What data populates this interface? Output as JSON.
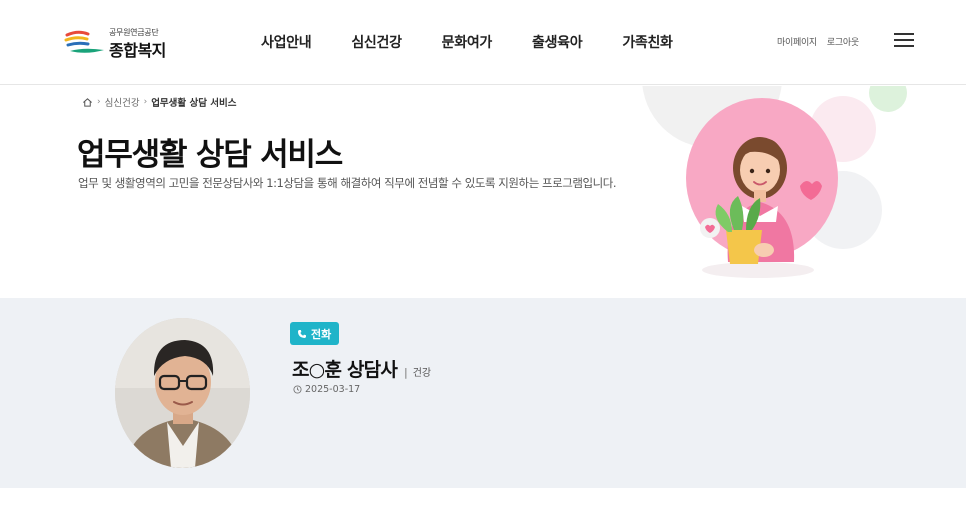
{
  "header": {
    "logo": {
      "org_small": "공무원연금공단",
      "org_big": "종합복지"
    },
    "nav": [
      "사업안내",
      "심신건강",
      "문화여가",
      "출생육아",
      "가족친화"
    ],
    "util": {
      "mypage": "마이페이지",
      "logout": "로그아웃"
    },
    "icons": {
      "menu": "hamburger-icon",
      "home": "home-icon"
    }
  },
  "hero": {
    "breadcrumb": {
      "level1": "심신건강",
      "current": "업무생활 상담 서비스",
      "separator": "›"
    },
    "title": "업무생활 상담 서비스",
    "description": "업무 및 생활영역의 고민을 전문상담사와 1:1상담을 통해 해결하여 직무에 전념할 수 있도록 지원하는 프로그램입니다.",
    "illustration": "counselor-woman-with-plant-illustration"
  },
  "counselor": {
    "badge": "전화",
    "badge_icon": "phone-icon",
    "name": "조○훈 상담사",
    "separator": "|",
    "field": "건강",
    "date": "2025-03-17",
    "date_icon": "clock-icon"
  },
  "colors": {
    "accent_teal": "#1fb4c9",
    "band_bg": "#eef1f5",
    "logo_red": "#e84a3a",
    "logo_yellow": "#f2b51d",
    "logo_blue": "#2a6fb8",
    "logo_green": "#1aa37a",
    "hero_pink": "#f8a8c4"
  }
}
